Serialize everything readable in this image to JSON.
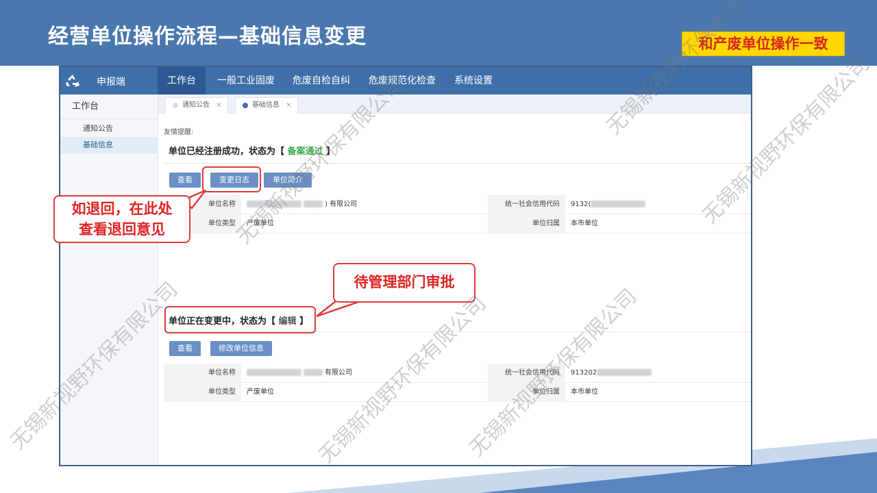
{
  "slide": {
    "title": "经营单位操作流程—基础信息变更",
    "note": "和产废单位操作一致"
  },
  "app": {
    "brand": "申报端",
    "nav": [
      "工作台",
      "一般工业固废",
      "危废自检自纠",
      "危废规范化检查",
      "系统设置"
    ],
    "sidebar": {
      "head": "工作台",
      "items": [
        "通知公告",
        "基础信息"
      ]
    },
    "tabs": [
      {
        "label": "通知公告",
        "close": "×"
      },
      {
        "label": "基础信息",
        "close": "×"
      }
    ],
    "reminder": "友情提醒:",
    "section1": {
      "status_prefix": "单位已经注册成功，状态为【 ",
      "status_value": "备案通过",
      "status_suffix": " 】",
      "buttons": [
        "查看",
        "变更日志",
        "单位简介"
      ],
      "rows": [
        {
          "label": "单位名称",
          "value": ") 有限公司",
          "label2": "统一社会信用代码",
          "value2": "9132("
        },
        {
          "label": "单位类型",
          "value": "产废单位",
          "label2": "单位归属",
          "value2": "本市单位"
        }
      ]
    },
    "section2": {
      "status_prefix": "单位正在变更中，状态为【 ",
      "status_value": "编辑",
      "status_suffix": " 】",
      "buttons": [
        "查看",
        "修改单位信息"
      ],
      "rows": [
        {
          "label": "单位名称",
          "value": "有限公司",
          "label2": "统一社会信用代码",
          "value2": "913202"
        },
        {
          "label": "单位类型",
          "value": "产废单位",
          "label2": "单位归属",
          "value2": "本市单位"
        }
      ]
    }
  },
  "callouts": {
    "left": "如退回，在此处\n查看退回意见",
    "right": "待管理部门审批"
  },
  "watermark": "无锡新视野环保有限公司",
  "colors": {
    "banner": "#4a78ae",
    "nav": "#3f6fa8",
    "button": "#6b8fc6",
    "callout_red": "#e03a3a",
    "status_green": "#3aa84a",
    "badge_yellow": "#ffd800"
  }
}
